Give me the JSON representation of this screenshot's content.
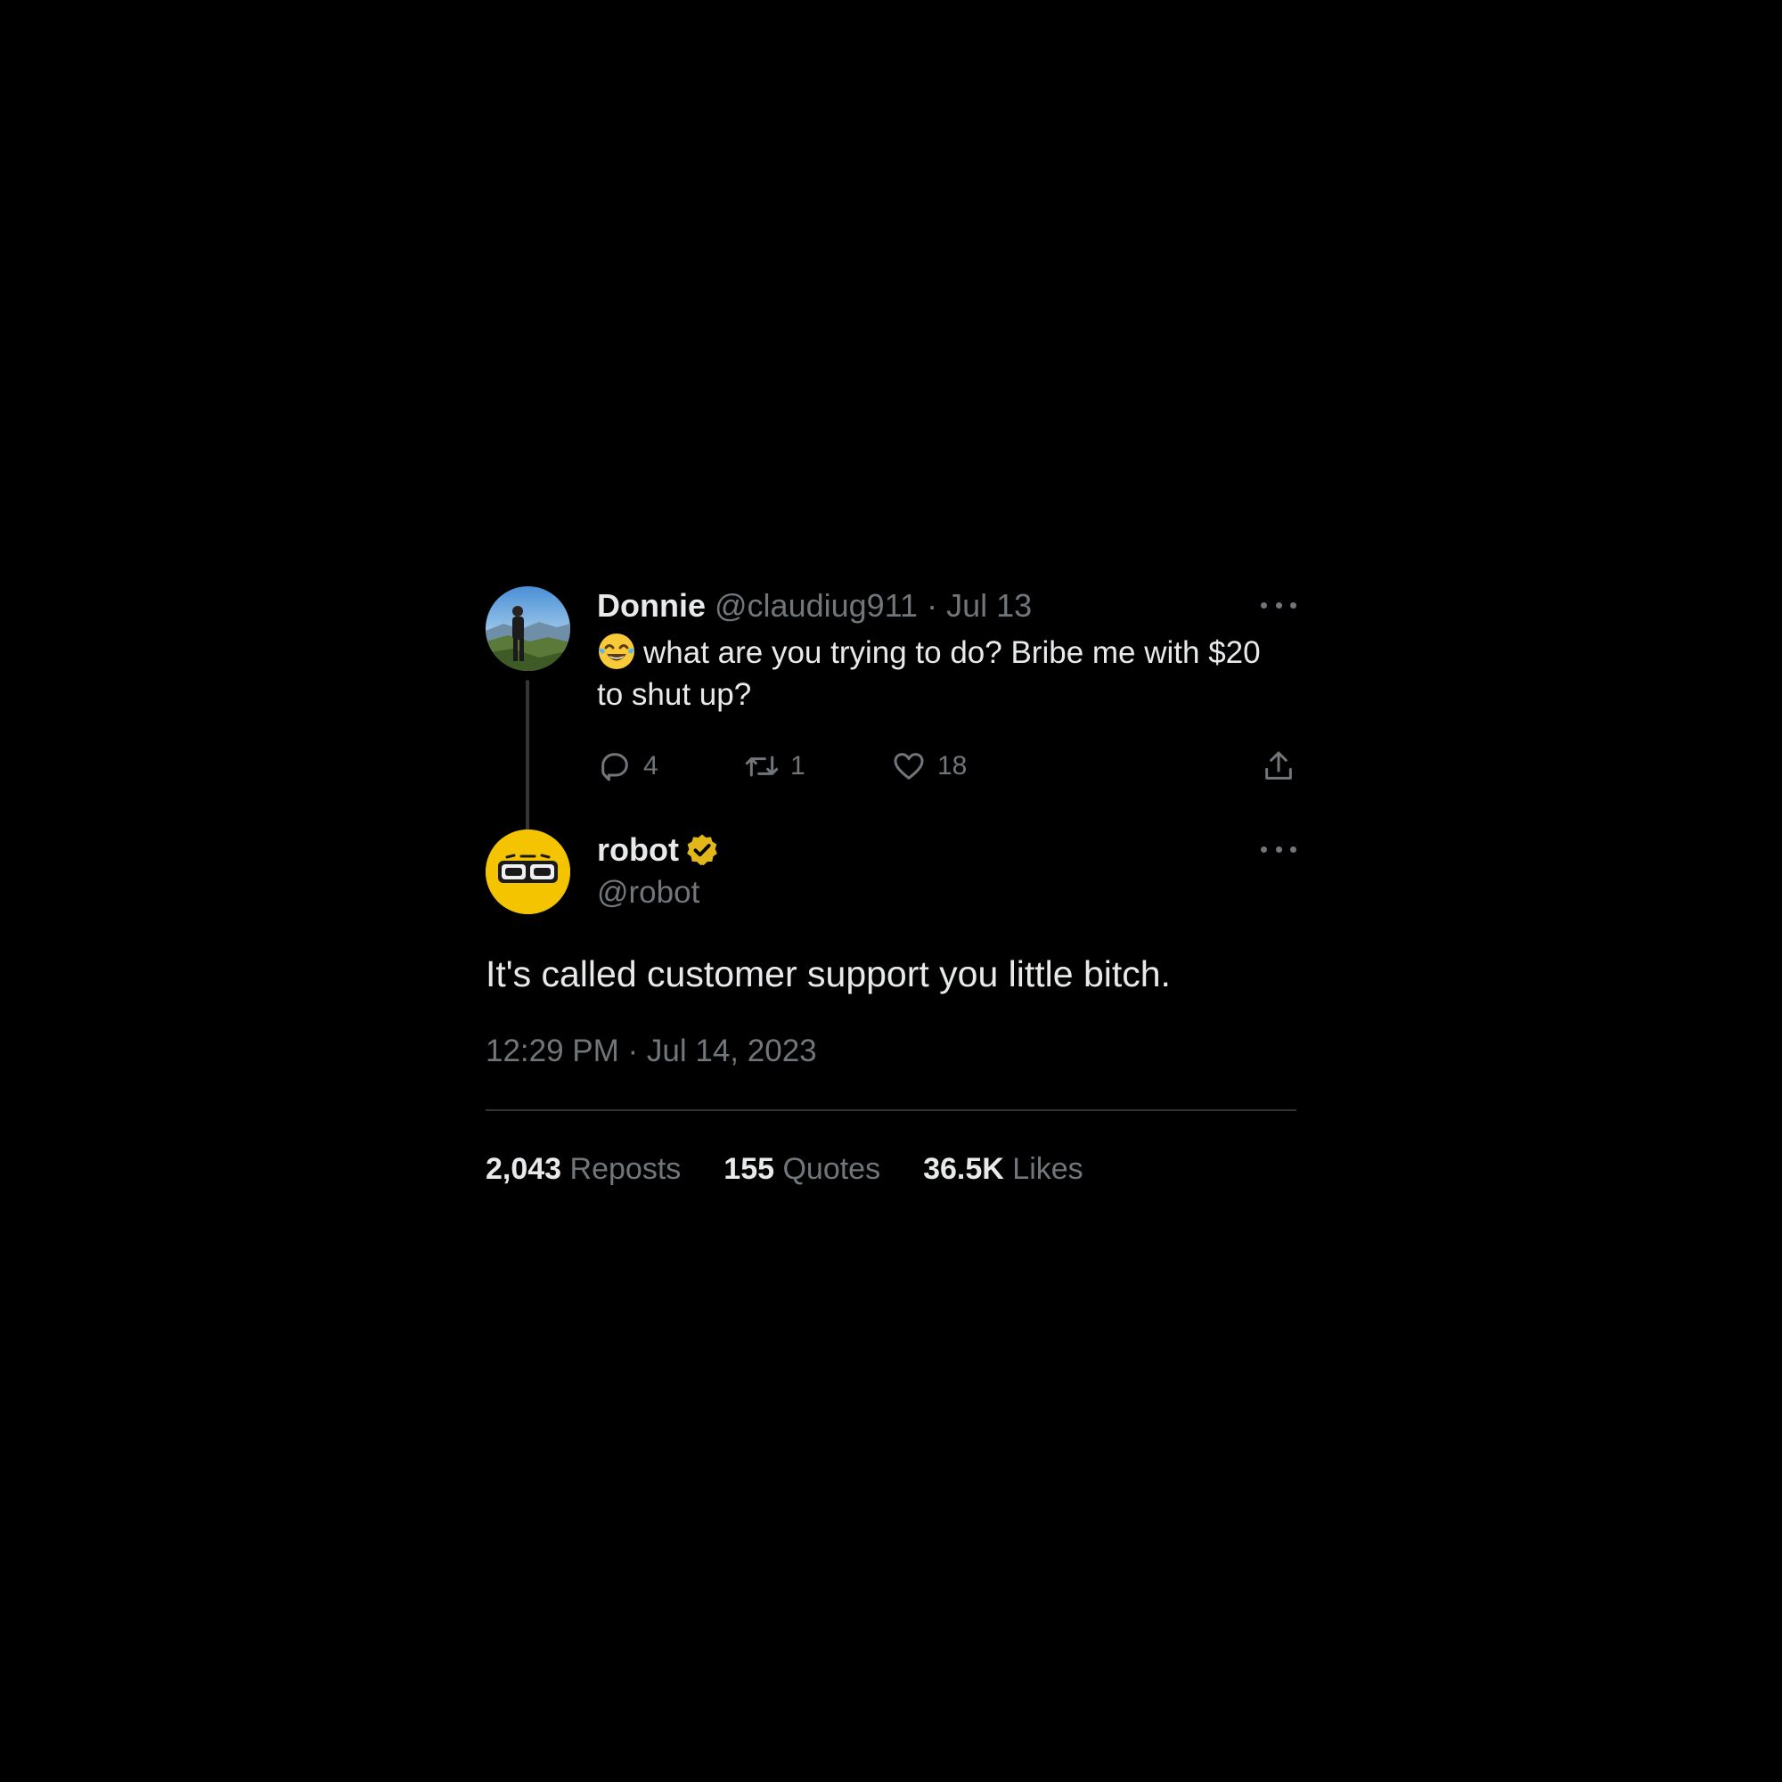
{
  "parent_tweet": {
    "display_name": "Donnie",
    "handle": "@claudiug911",
    "separator": "·",
    "date": "Jul 13",
    "text": "what are you trying to do? Bribe me with $20 to shut up?",
    "emoji_icon": "face-with-tears-of-joy-icon",
    "replies": "4",
    "reposts": "1",
    "likes": "18"
  },
  "main_tweet": {
    "display_name": "robot",
    "handle": "@robot",
    "verified_color": "#e2b719",
    "avatar_color": "#f5c400",
    "text": "It's called customer support you little bitch.",
    "timestamp": "12:29 PM · Jul 14, 2023",
    "stats": [
      {
        "count": "2,043",
        "label": "Reposts"
      },
      {
        "count": "155",
        "label": "Quotes"
      },
      {
        "count": "36.5K",
        "label": "Likes"
      }
    ]
  },
  "colors": {
    "background": "#000000",
    "primary_text": "#e7e9ea",
    "secondary_text": "#71767b",
    "divider": "#2f3336"
  }
}
